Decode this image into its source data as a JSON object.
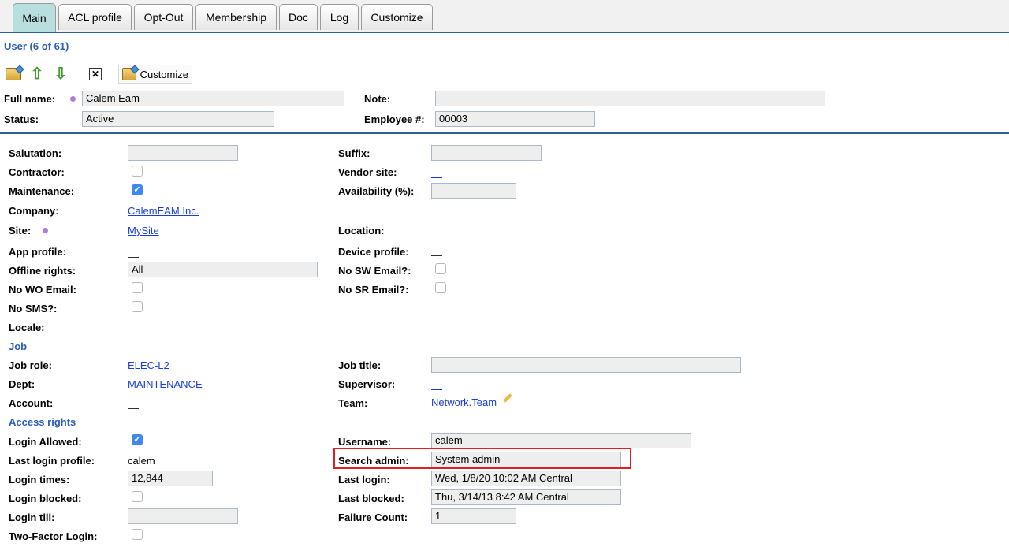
{
  "tabs": [
    "Main",
    "ACL profile",
    "Opt-Out",
    "Membership",
    "Doc",
    "Log",
    "Customize"
  ],
  "section_title": "User (6 of 61)",
  "toolbar": {
    "customize_label": "Customize"
  },
  "header": {
    "full_name_label": "Full name:",
    "full_name_value": "Calem Eam",
    "note_label": "Note:",
    "note_value": "",
    "status_label": "Status:",
    "status_value": "Active",
    "employee_label": "Employee #:",
    "employee_value": "00003"
  },
  "fields": {
    "salutation_label": "Salutation:",
    "salutation_value": "",
    "suffix_label": "Suffix:",
    "suffix_value": "",
    "contractor_label": "Contractor:",
    "contractor_checked": false,
    "vendor_site_label": "Vendor site:",
    "maintenance_label": "Maintenance:",
    "maintenance_checked": true,
    "availability_label": "Availability (%):",
    "availability_value": "",
    "company_label": "Company:",
    "company_value": "CalemEAM Inc.",
    "site_label": "Site:",
    "site_value": "MySite",
    "location_label": "Location:",
    "app_profile_label": "App profile:",
    "device_profile_label": "Device profile:",
    "offline_rights_label": "Offline rights:",
    "offline_rights_value": "All",
    "no_sw_email_label": "No SW Email?:",
    "no_sw_email_checked": false,
    "no_wo_email_label": "No WO Email:",
    "no_wo_email_checked": false,
    "no_sr_email_label": "No SR Email?:",
    "no_sr_email_checked": false,
    "no_sms_label": "No SMS?:",
    "no_sms_checked": false,
    "locale_label": "Locale:"
  },
  "job": {
    "title": "Job",
    "job_role_label": "Job role:",
    "job_role_value": "ELEC-L2",
    "job_title_label": "Job title:",
    "job_title_value": "",
    "dept_label": "Dept:",
    "dept_value": "MAINTENANCE",
    "supervisor_label": "Supervisor:",
    "account_label": "Account:",
    "team_label": "Team:",
    "team_value": "Network.Team"
  },
  "access": {
    "title": "Access rights",
    "login_allowed_label": "Login Allowed:",
    "login_allowed_checked": true,
    "username_label": "Username:",
    "username_value": "calem",
    "last_login_profile_label": "Last login profile:",
    "last_login_profile_value": "calem",
    "search_admin_label": "Search admin:",
    "search_admin_value": "System admin",
    "login_times_label": "Login times:",
    "login_times_value": "12,844",
    "last_login_label": "Last login:",
    "last_login_value": "Wed, 1/8/20 10:02 AM Central",
    "login_blocked_label": "Login blocked:",
    "login_blocked_checked": false,
    "last_blocked_label": "Last blocked:",
    "last_blocked_value": "Thu, 3/14/13 8:42 AM Central",
    "login_till_label": "Login till:",
    "login_till_value": "",
    "failure_count_label": "Failure Count:",
    "failure_count_value": "1",
    "two_factor_label": "Two-Factor Login:",
    "two_factor_checked": false
  },
  "colors": {
    "accent": "#2b5fb4",
    "link": "#1a3fd6",
    "highlight": "#e02020",
    "active_tab": "#b9dede"
  }
}
